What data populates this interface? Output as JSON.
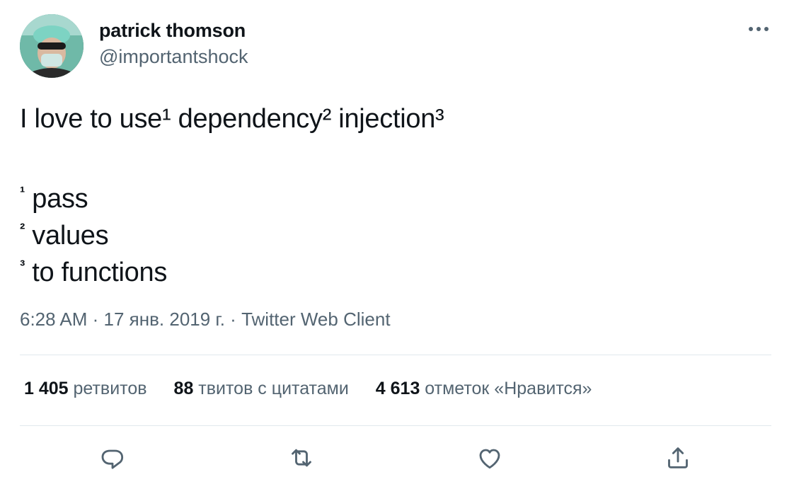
{
  "author": {
    "display_name": "patrick thomson",
    "handle": "@importantshock"
  },
  "tweet": {
    "text_line1": [
      "I love to use",
      "¹",
      " dependency",
      "²",
      " injection",
      "³"
    ],
    "footnotes": [
      {
        "mark": "¹",
        "text": " pass"
      },
      {
        "mark": "²",
        "text": " values"
      },
      {
        "mark": "³",
        "text": " to functions"
      }
    ]
  },
  "meta": {
    "time": "6:28 AM",
    "separator": " · ",
    "date": "17 янв. 2019 г.",
    "source": "Twitter Web Client"
  },
  "stats": [
    {
      "count": "1 405",
      "label": " ретвитов"
    },
    {
      "count": "88",
      "label": " твитов с цитатами"
    },
    {
      "count": "4 613",
      "label": " отметок «Нравится»"
    }
  ],
  "icons": {
    "more": "more-horizontal-icon",
    "reply": "reply-icon",
    "retweet": "retweet-icon",
    "like": "heart-icon",
    "share": "share-icon"
  },
  "colors": {
    "text_primary": "#0f1419",
    "text_secondary": "#536471",
    "divider": "#e1e8ed"
  }
}
